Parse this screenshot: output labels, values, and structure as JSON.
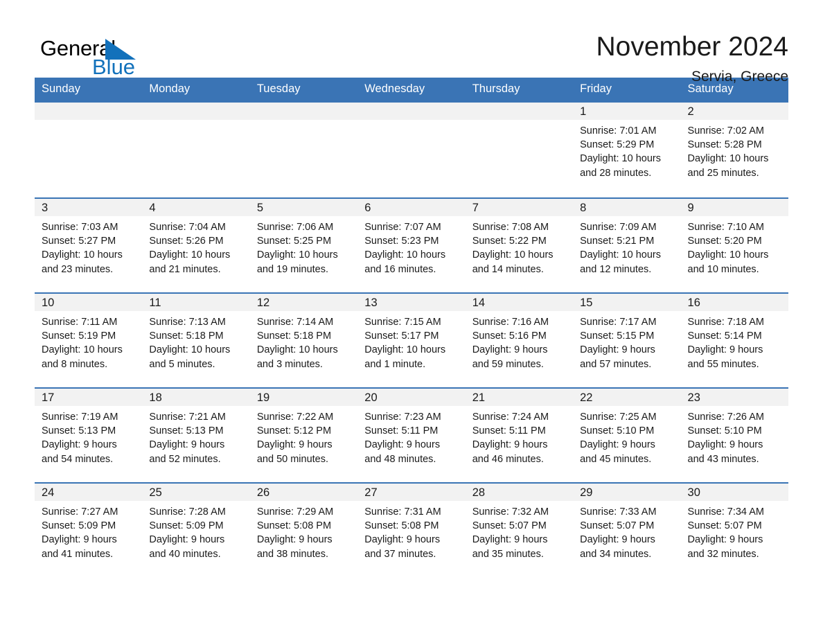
{
  "brand": {
    "name_part1": "General",
    "name_part2": "Blue"
  },
  "header": {
    "title": "November 2024",
    "location": "Servia, Greece"
  },
  "weekday_headers": [
    "Sunday",
    "Monday",
    "Tuesday",
    "Wednesday",
    "Thursday",
    "Friday",
    "Saturday"
  ],
  "colors": {
    "header_blue": "#3a74b5",
    "logo_blue": "#1271bb",
    "daynum_band": "#f2f2f2",
    "text": "#1a1a1a"
  },
  "weeks": [
    [
      {
        "empty": true
      },
      {
        "empty": true
      },
      {
        "empty": true
      },
      {
        "empty": true
      },
      {
        "empty": true
      },
      {
        "day": "1",
        "sunrise": "Sunrise: 7:01 AM",
        "sunset": "Sunset: 5:29 PM",
        "daylight1": "Daylight: 10 hours",
        "daylight2": "and 28 minutes."
      },
      {
        "day": "2",
        "sunrise": "Sunrise: 7:02 AM",
        "sunset": "Sunset: 5:28 PM",
        "daylight1": "Daylight: 10 hours",
        "daylight2": "and 25 minutes."
      }
    ],
    [
      {
        "day": "3",
        "sunrise": "Sunrise: 7:03 AM",
        "sunset": "Sunset: 5:27 PM",
        "daylight1": "Daylight: 10 hours",
        "daylight2": "and 23 minutes."
      },
      {
        "day": "4",
        "sunrise": "Sunrise: 7:04 AM",
        "sunset": "Sunset: 5:26 PM",
        "daylight1": "Daylight: 10 hours",
        "daylight2": "and 21 minutes."
      },
      {
        "day": "5",
        "sunrise": "Sunrise: 7:06 AM",
        "sunset": "Sunset: 5:25 PM",
        "daylight1": "Daylight: 10 hours",
        "daylight2": "and 19 minutes."
      },
      {
        "day": "6",
        "sunrise": "Sunrise: 7:07 AM",
        "sunset": "Sunset: 5:23 PM",
        "daylight1": "Daylight: 10 hours",
        "daylight2": "and 16 minutes."
      },
      {
        "day": "7",
        "sunrise": "Sunrise: 7:08 AM",
        "sunset": "Sunset: 5:22 PM",
        "daylight1": "Daylight: 10 hours",
        "daylight2": "and 14 minutes."
      },
      {
        "day": "8",
        "sunrise": "Sunrise: 7:09 AM",
        "sunset": "Sunset: 5:21 PM",
        "daylight1": "Daylight: 10 hours",
        "daylight2": "and 12 minutes."
      },
      {
        "day": "9",
        "sunrise": "Sunrise: 7:10 AM",
        "sunset": "Sunset: 5:20 PM",
        "daylight1": "Daylight: 10 hours",
        "daylight2": "and 10 minutes."
      }
    ],
    [
      {
        "day": "10",
        "sunrise": "Sunrise: 7:11 AM",
        "sunset": "Sunset: 5:19 PM",
        "daylight1": "Daylight: 10 hours",
        "daylight2": "and 8 minutes."
      },
      {
        "day": "11",
        "sunrise": "Sunrise: 7:13 AM",
        "sunset": "Sunset: 5:18 PM",
        "daylight1": "Daylight: 10 hours",
        "daylight2": "and 5 minutes."
      },
      {
        "day": "12",
        "sunrise": "Sunrise: 7:14 AM",
        "sunset": "Sunset: 5:18 PM",
        "daylight1": "Daylight: 10 hours",
        "daylight2": "and 3 minutes."
      },
      {
        "day": "13",
        "sunrise": "Sunrise: 7:15 AM",
        "sunset": "Sunset: 5:17 PM",
        "daylight1": "Daylight: 10 hours",
        "daylight2": "and 1 minute."
      },
      {
        "day": "14",
        "sunrise": "Sunrise: 7:16 AM",
        "sunset": "Sunset: 5:16 PM",
        "daylight1": "Daylight: 9 hours",
        "daylight2": "and 59 minutes."
      },
      {
        "day": "15",
        "sunrise": "Sunrise: 7:17 AM",
        "sunset": "Sunset: 5:15 PM",
        "daylight1": "Daylight: 9 hours",
        "daylight2": "and 57 minutes."
      },
      {
        "day": "16",
        "sunrise": "Sunrise: 7:18 AM",
        "sunset": "Sunset: 5:14 PM",
        "daylight1": "Daylight: 9 hours",
        "daylight2": "and 55 minutes."
      }
    ],
    [
      {
        "day": "17",
        "sunrise": "Sunrise: 7:19 AM",
        "sunset": "Sunset: 5:13 PM",
        "daylight1": "Daylight: 9 hours",
        "daylight2": "and 54 minutes."
      },
      {
        "day": "18",
        "sunrise": "Sunrise: 7:21 AM",
        "sunset": "Sunset: 5:13 PM",
        "daylight1": "Daylight: 9 hours",
        "daylight2": "and 52 minutes."
      },
      {
        "day": "19",
        "sunrise": "Sunrise: 7:22 AM",
        "sunset": "Sunset: 5:12 PM",
        "daylight1": "Daylight: 9 hours",
        "daylight2": "and 50 minutes."
      },
      {
        "day": "20",
        "sunrise": "Sunrise: 7:23 AM",
        "sunset": "Sunset: 5:11 PM",
        "daylight1": "Daylight: 9 hours",
        "daylight2": "and 48 minutes."
      },
      {
        "day": "21",
        "sunrise": "Sunrise: 7:24 AM",
        "sunset": "Sunset: 5:11 PM",
        "daylight1": "Daylight: 9 hours",
        "daylight2": "and 46 minutes."
      },
      {
        "day": "22",
        "sunrise": "Sunrise: 7:25 AM",
        "sunset": "Sunset: 5:10 PM",
        "daylight1": "Daylight: 9 hours",
        "daylight2": "and 45 minutes."
      },
      {
        "day": "23",
        "sunrise": "Sunrise: 7:26 AM",
        "sunset": "Sunset: 5:10 PM",
        "daylight1": "Daylight: 9 hours",
        "daylight2": "and 43 minutes."
      }
    ],
    [
      {
        "day": "24",
        "sunrise": "Sunrise: 7:27 AM",
        "sunset": "Sunset: 5:09 PM",
        "daylight1": "Daylight: 9 hours",
        "daylight2": "and 41 minutes."
      },
      {
        "day": "25",
        "sunrise": "Sunrise: 7:28 AM",
        "sunset": "Sunset: 5:09 PM",
        "daylight1": "Daylight: 9 hours",
        "daylight2": "and 40 minutes."
      },
      {
        "day": "26",
        "sunrise": "Sunrise: 7:29 AM",
        "sunset": "Sunset: 5:08 PM",
        "daylight1": "Daylight: 9 hours",
        "daylight2": "and 38 minutes."
      },
      {
        "day": "27",
        "sunrise": "Sunrise: 7:31 AM",
        "sunset": "Sunset: 5:08 PM",
        "daylight1": "Daylight: 9 hours",
        "daylight2": "and 37 minutes."
      },
      {
        "day": "28",
        "sunrise": "Sunrise: 7:32 AM",
        "sunset": "Sunset: 5:07 PM",
        "daylight1": "Daylight: 9 hours",
        "daylight2": "and 35 minutes."
      },
      {
        "day": "29",
        "sunrise": "Sunrise: 7:33 AM",
        "sunset": "Sunset: 5:07 PM",
        "daylight1": "Daylight: 9 hours",
        "daylight2": "and 34 minutes."
      },
      {
        "day": "30",
        "sunrise": "Sunrise: 7:34 AM",
        "sunset": "Sunset: 5:07 PM",
        "daylight1": "Daylight: 9 hours",
        "daylight2": "and 32 minutes."
      }
    ]
  ]
}
